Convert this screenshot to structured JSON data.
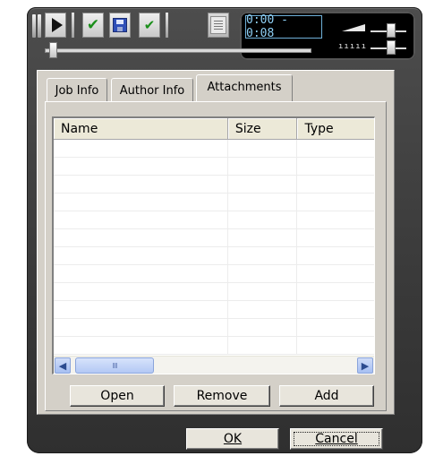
{
  "player": {
    "time_display": "0:00 - 0:08",
    "speed_scale": "ııııı",
    "position_slider_value": 0,
    "icons": {
      "play": "play-icon",
      "accept": "checkmark-icon",
      "save": "save-disk-icon",
      "accept_all": "checkmark-double-icon",
      "properties": "properties-doc-icon"
    }
  },
  "tabs": [
    {
      "label": "Job Info"
    },
    {
      "label": "Author Info"
    },
    {
      "label": "Attachments",
      "active": true
    }
  ],
  "attachments_list": {
    "columns": [
      "Name",
      "Size",
      "Type"
    ],
    "rows": [],
    "scroll_left_glyph": "◀",
    "scroll_right_glyph": "▶",
    "thumb_grip": "IIII"
  },
  "buttons": {
    "open": "Open",
    "remove": "Remove",
    "add": "Add",
    "ok": "OK",
    "cancel": "Cancel"
  },
  "colors": {
    "skin": "#3a3a3a",
    "dialog": "#d4d0c8",
    "time_text": "#8fd0f5",
    "check_green": "#1b8f1b",
    "save_blue": "#2f4fb8"
  }
}
